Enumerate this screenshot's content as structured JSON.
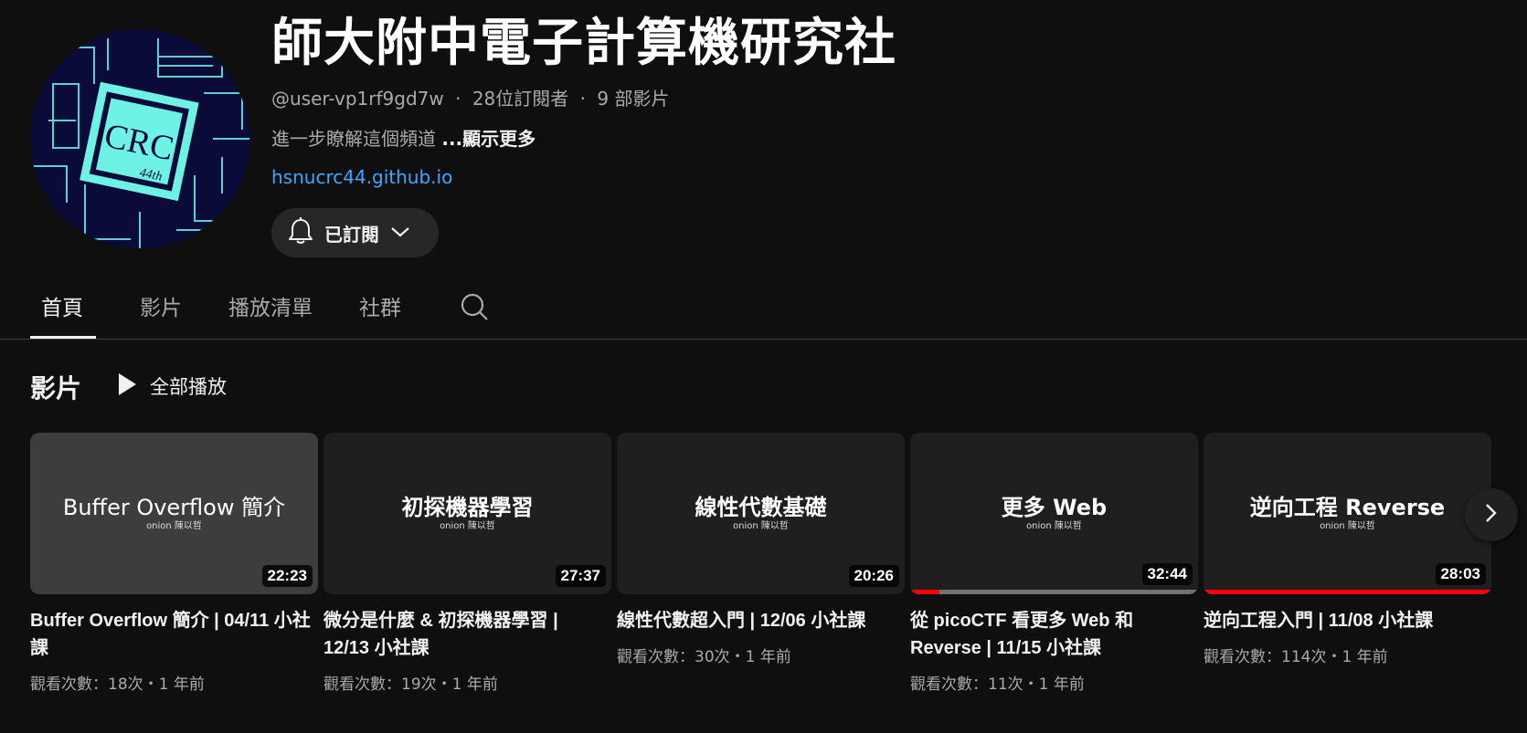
{
  "channel": {
    "name": "師大附中電子計算機研究社",
    "handle": "@user-vp1rf9gd7w",
    "subscribers": "28位訂閱者",
    "video_count": "9 部影片",
    "separator": "‧",
    "description": "進一步瞭解這個頻道",
    "show_more": "...顯示更多",
    "link": "hsnucrc44.github.io",
    "avatar_text": "CRC",
    "avatar_subtext": "44th",
    "subscribe_label": "已訂閱",
    "subscribe_icon": "bell-icon"
  },
  "tabs": [
    {
      "label": "首頁",
      "active": true
    },
    {
      "label": "影片",
      "active": false
    },
    {
      "label": "播放清單",
      "active": false
    },
    {
      "label": "社群",
      "active": false
    }
  ],
  "section": {
    "title": "影片",
    "play_all": "全部播放"
  },
  "videos": [
    {
      "thumb_title": "Buffer Overflow 簡介",
      "thumb_sub": "onion 陳以哲",
      "duration": "22:23",
      "title": "Buffer Overflow 簡介 | 04/11 小社課",
      "meta": "觀看次數：18次・1 年前",
      "progress": 0
    },
    {
      "thumb_title": "初探機器學習",
      "thumb_sub": "onion 陳以哲",
      "duration": "27:37",
      "title": "微分是什麼 & 初探機器學習 | 12/13 小社課",
      "meta": "觀看次數：19次・1 年前",
      "progress": 0
    },
    {
      "thumb_title": "線性代數基礎",
      "thumb_sub": "onion 陳以哲",
      "duration": "20:26",
      "title": "線性代數超入門 | 12/06 小社課",
      "meta": "觀看次數：30次・1 年前",
      "progress": 0
    },
    {
      "thumb_title": "更多 Web",
      "thumb_sub": "onion 陳以哲",
      "duration": "32:44",
      "title": "從 picoCTF 看更多 Web 和 Reverse | 11/15 小社課",
      "meta": "觀看次數：11次・1 年前",
      "progress": 0.1
    },
    {
      "thumb_title": "逆向工程 Reverse",
      "thumb_sub": "onion 陳以哲",
      "duration": "28:03",
      "title": "逆向工程入門 | 11/08 小社課",
      "meta": "觀看次數：114次・1 年前",
      "progress": 1.0
    }
  ],
  "icons": {
    "search": "search-icon",
    "chevron": "chevron-down-icon",
    "play": "play-icon",
    "next": "chevron-right-icon"
  },
  "colors": {
    "background": "#0f0f0f",
    "link": "#3ea6ff",
    "progress": "#ff0000",
    "avatar_bg": "#0b0b3a",
    "avatar_accent": "#6ff2e6"
  }
}
